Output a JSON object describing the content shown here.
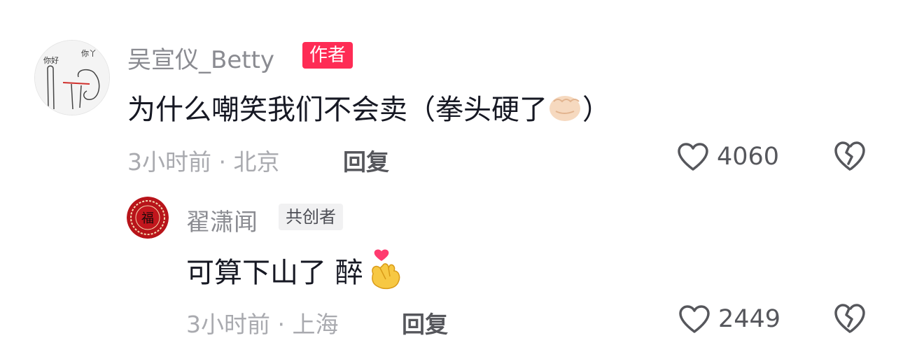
{
  "comments": [
    {
      "username": "吴宣仪_Betty",
      "tag": "作者",
      "text": "为什么嘲笑我们不会卖（拳头硬了",
      "text_end": "）",
      "emoji": "fist-emoji",
      "time": "3小时前",
      "location": "北京",
      "reply_label": "回复",
      "likes": "4060",
      "avatar_text": [
        "你好",
        "你丫"
      ]
    },
    {
      "username": "翟潇闻",
      "tag": "共创者",
      "text": "可算下山了 醉",
      "emoji": "finger-heart-emoji",
      "time": "3小时前",
      "location": "上海",
      "reply_label": "回复",
      "likes": "2449",
      "avatar_text": "福"
    }
  ],
  "colors": {
    "author_tag": "#fe2c55",
    "cocreator_tag_bg": "#f1f1f2",
    "meta": "#a9aaaf",
    "username": "#8a8b91"
  }
}
